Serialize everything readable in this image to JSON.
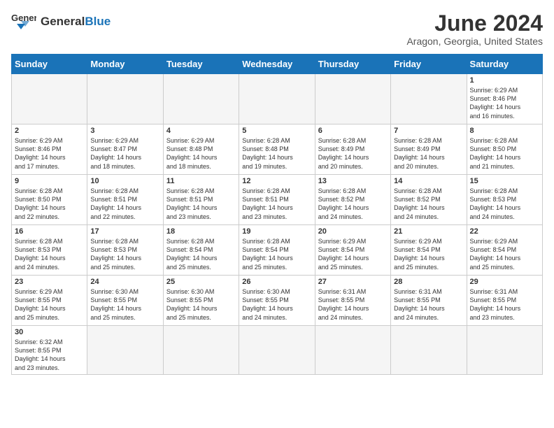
{
  "header": {
    "logo_general": "General",
    "logo_blue": "Blue",
    "month": "June 2024",
    "location": "Aragon, Georgia, United States"
  },
  "weekdays": [
    "Sunday",
    "Monday",
    "Tuesday",
    "Wednesday",
    "Thursday",
    "Friday",
    "Saturday"
  ],
  "weeks": [
    [
      {
        "day": null,
        "info": null
      },
      {
        "day": null,
        "info": null
      },
      {
        "day": null,
        "info": null
      },
      {
        "day": null,
        "info": null
      },
      {
        "day": null,
        "info": null
      },
      {
        "day": null,
        "info": null
      },
      {
        "day": "1",
        "info": "Sunrise: 6:29 AM\nSunset: 8:46 PM\nDaylight: 14 hours\nand 16 minutes."
      }
    ],
    [
      {
        "day": "2",
        "info": "Sunrise: 6:29 AM\nSunset: 8:46 PM\nDaylight: 14 hours\nand 17 minutes."
      },
      {
        "day": "3",
        "info": "Sunrise: 6:29 AM\nSunset: 8:47 PM\nDaylight: 14 hours\nand 18 minutes."
      },
      {
        "day": "4",
        "info": "Sunrise: 6:29 AM\nSunset: 8:48 PM\nDaylight: 14 hours\nand 18 minutes."
      },
      {
        "day": "5",
        "info": "Sunrise: 6:28 AM\nSunset: 8:48 PM\nDaylight: 14 hours\nand 19 minutes."
      },
      {
        "day": "6",
        "info": "Sunrise: 6:28 AM\nSunset: 8:49 PM\nDaylight: 14 hours\nand 20 minutes."
      },
      {
        "day": "7",
        "info": "Sunrise: 6:28 AM\nSunset: 8:49 PM\nDaylight: 14 hours\nand 20 minutes."
      },
      {
        "day": "8",
        "info": "Sunrise: 6:28 AM\nSunset: 8:50 PM\nDaylight: 14 hours\nand 21 minutes."
      }
    ],
    [
      {
        "day": "9",
        "info": "Sunrise: 6:28 AM\nSunset: 8:50 PM\nDaylight: 14 hours\nand 22 minutes."
      },
      {
        "day": "10",
        "info": "Sunrise: 6:28 AM\nSunset: 8:51 PM\nDaylight: 14 hours\nand 22 minutes."
      },
      {
        "day": "11",
        "info": "Sunrise: 6:28 AM\nSunset: 8:51 PM\nDaylight: 14 hours\nand 23 minutes."
      },
      {
        "day": "12",
        "info": "Sunrise: 6:28 AM\nSunset: 8:51 PM\nDaylight: 14 hours\nand 23 minutes."
      },
      {
        "day": "13",
        "info": "Sunrise: 6:28 AM\nSunset: 8:52 PM\nDaylight: 14 hours\nand 24 minutes."
      },
      {
        "day": "14",
        "info": "Sunrise: 6:28 AM\nSunset: 8:52 PM\nDaylight: 14 hours\nand 24 minutes."
      },
      {
        "day": "15",
        "info": "Sunrise: 6:28 AM\nSunset: 8:53 PM\nDaylight: 14 hours\nand 24 minutes."
      }
    ],
    [
      {
        "day": "16",
        "info": "Sunrise: 6:28 AM\nSunset: 8:53 PM\nDaylight: 14 hours\nand 24 minutes."
      },
      {
        "day": "17",
        "info": "Sunrise: 6:28 AM\nSunset: 8:53 PM\nDaylight: 14 hours\nand 25 minutes."
      },
      {
        "day": "18",
        "info": "Sunrise: 6:28 AM\nSunset: 8:54 PM\nDaylight: 14 hours\nand 25 minutes."
      },
      {
        "day": "19",
        "info": "Sunrise: 6:28 AM\nSunset: 8:54 PM\nDaylight: 14 hours\nand 25 minutes."
      },
      {
        "day": "20",
        "info": "Sunrise: 6:29 AM\nSunset: 8:54 PM\nDaylight: 14 hours\nand 25 minutes."
      },
      {
        "day": "21",
        "info": "Sunrise: 6:29 AM\nSunset: 8:54 PM\nDaylight: 14 hours\nand 25 minutes."
      },
      {
        "day": "22",
        "info": "Sunrise: 6:29 AM\nSunset: 8:54 PM\nDaylight: 14 hours\nand 25 minutes."
      }
    ],
    [
      {
        "day": "23",
        "info": "Sunrise: 6:29 AM\nSunset: 8:55 PM\nDaylight: 14 hours\nand 25 minutes."
      },
      {
        "day": "24",
        "info": "Sunrise: 6:30 AM\nSunset: 8:55 PM\nDaylight: 14 hours\nand 25 minutes."
      },
      {
        "day": "25",
        "info": "Sunrise: 6:30 AM\nSunset: 8:55 PM\nDaylight: 14 hours\nand 25 minutes."
      },
      {
        "day": "26",
        "info": "Sunrise: 6:30 AM\nSunset: 8:55 PM\nDaylight: 14 hours\nand 24 minutes."
      },
      {
        "day": "27",
        "info": "Sunrise: 6:31 AM\nSunset: 8:55 PM\nDaylight: 14 hours\nand 24 minutes."
      },
      {
        "day": "28",
        "info": "Sunrise: 6:31 AM\nSunset: 8:55 PM\nDaylight: 14 hours\nand 24 minutes."
      },
      {
        "day": "29",
        "info": "Sunrise: 6:31 AM\nSunset: 8:55 PM\nDaylight: 14 hours\nand 23 minutes."
      }
    ],
    [
      {
        "day": "30",
        "info": "Sunrise: 6:32 AM\nSunset: 8:55 PM\nDaylight: 14 hours\nand 23 minutes."
      },
      {
        "day": null,
        "info": null
      },
      {
        "day": null,
        "info": null
      },
      {
        "day": null,
        "info": null
      },
      {
        "day": null,
        "info": null
      },
      {
        "day": null,
        "info": null
      },
      {
        "day": null,
        "info": null
      }
    ]
  ]
}
